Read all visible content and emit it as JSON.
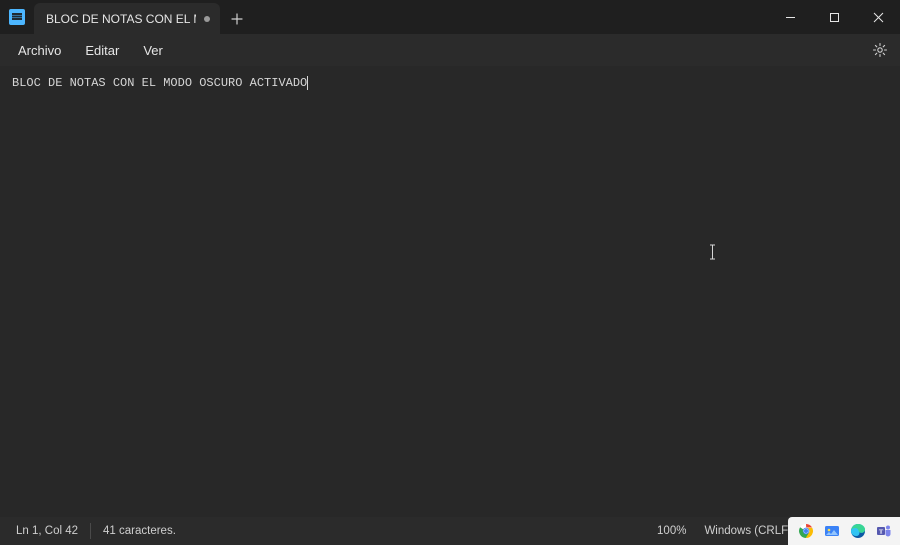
{
  "titlebar": {
    "tab_title": "BLOC DE NOTAS CON EL MODO OS",
    "app_icon_name": "notepad-icon"
  },
  "menubar": {
    "file": "Archivo",
    "edit": "Editar",
    "view": "Ver"
  },
  "editor": {
    "content": "BLOC DE NOTAS CON EL MODO OSCURO ACTIVADO"
  },
  "statusbar": {
    "position": "Ln 1, Col 42",
    "char_count": "41 caracteres.",
    "zoom": "100%",
    "line_ending": "Windows (CRLF)"
  }
}
